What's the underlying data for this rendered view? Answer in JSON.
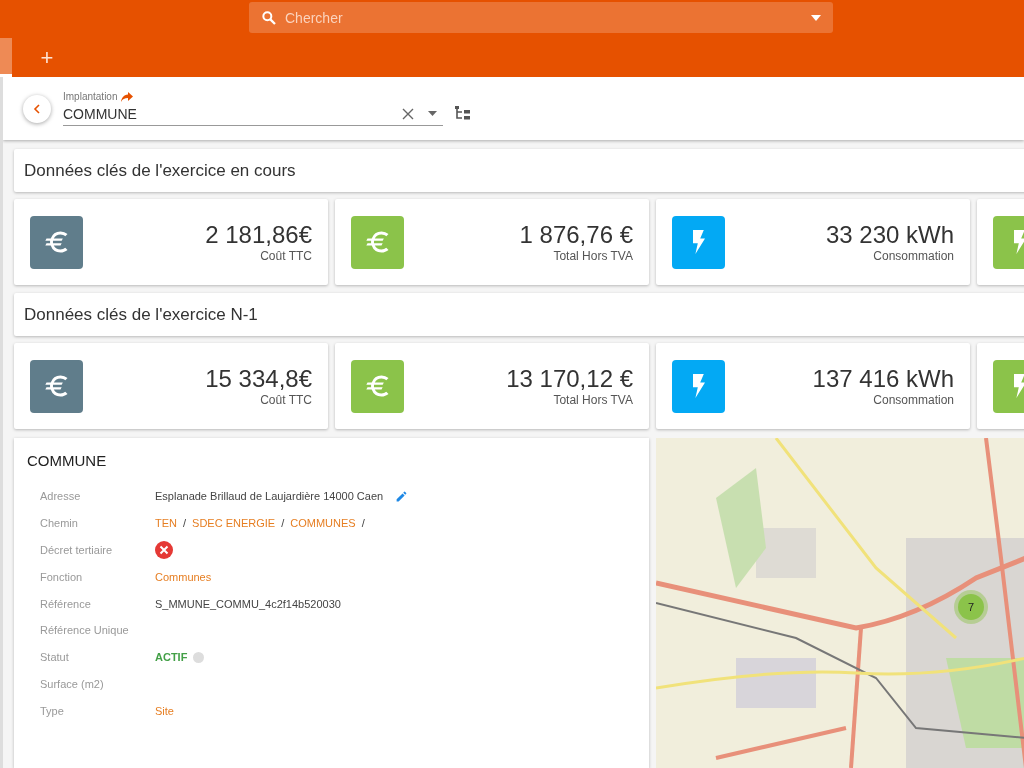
{
  "search": {
    "placeholder": "Chercher"
  },
  "tabs": [
    {
      "kind": "tab",
      "selected": true
    },
    {
      "kind": "add",
      "label": "+",
      "selected": false
    }
  ],
  "selector": {
    "label": "Implantation",
    "value": "COMMUNE"
  },
  "sections": [
    {
      "title": "Données clés de l'exercice en cours",
      "cards": [
        {
          "kind": "euro",
          "color": "#607d8b",
          "value": "2 181,86€",
          "label": "Coût TTC"
        },
        {
          "kind": "euro",
          "color": "#8bc34a",
          "value": "1 876,76 €",
          "label": "Total Hors TVA"
        },
        {
          "kind": "bolt",
          "color": "#03a9f4",
          "value": "33 230 kWh",
          "label": "Consommation"
        },
        {
          "kind": "bolt",
          "color": "#8bc34a"
        }
      ]
    },
    {
      "title": "Données clés de l'exercice N-1",
      "cards": [
        {
          "kind": "euro",
          "color": "#607d8b",
          "value": "15 334,8€",
          "label": "Coût TTC"
        },
        {
          "kind": "euro",
          "color": "#8bc34a",
          "value": "13 170,12 €",
          "label": "Total Hors TVA"
        },
        {
          "kind": "bolt",
          "color": "#03a9f4",
          "value": "137 416 kWh",
          "label": "Consommation"
        },
        {
          "kind": "bolt",
          "color": "#8bc34a"
        }
      ]
    }
  ],
  "details": {
    "title": "COMMUNE",
    "rows": [
      {
        "label": "Adresse",
        "kind": "text",
        "value": "Esplanade Brillaud de Laujardière 14000 Caen",
        "editable": true
      },
      {
        "label": "Chemin",
        "kind": "path",
        "parts": [
          "TEN",
          "SDEC ENERGIE",
          "COMMUNES"
        ],
        "separator": "/"
      },
      {
        "label": "Décret tertiaire",
        "kind": "flag",
        "checked": false
      },
      {
        "label": "Fonction",
        "kind": "link",
        "value": "Communes"
      },
      {
        "label": "Référence",
        "kind": "text",
        "value": "S_MMUNE_COMMU_4c2f14b520030"
      },
      {
        "label": "Référence Unique",
        "kind": "empty"
      },
      {
        "label": "Statut",
        "kind": "status",
        "value": "ACTIF"
      },
      {
        "label": "Surface (m2)",
        "kind": "empty"
      },
      {
        "label": "Type",
        "kind": "link",
        "value": "Site"
      }
    ]
  },
  "map": {
    "kind": "picture",
    "cluster": "7"
  }
}
